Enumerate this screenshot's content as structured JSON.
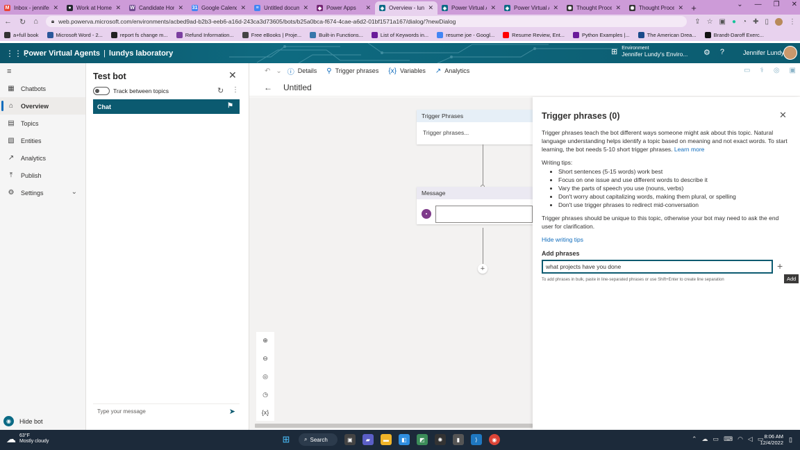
{
  "browser": {
    "tabs": [
      {
        "label": "Inbox - jennifer",
        "icon": "gmail-icon",
        "color": "#ea4335",
        "glyph": "M"
      },
      {
        "label": "Work at Home D",
        "icon": "github-icon",
        "color": "#24292e",
        "glyph": "●"
      },
      {
        "label": "Candidate Hom",
        "icon": "w-icon",
        "color": "#6d4a8c",
        "glyph": "W"
      },
      {
        "label": "Google Calenda",
        "icon": "calendar-icon",
        "color": "#4285f4",
        "glyph": "31"
      },
      {
        "label": "Untitled docum",
        "icon": "docs-icon",
        "color": "#4285f4",
        "glyph": "≡"
      },
      {
        "label": "Power Apps",
        "icon": "powerapps-icon",
        "color": "#742774",
        "glyph": "◆"
      },
      {
        "label": "Overview - lund",
        "icon": "pva-icon",
        "color": "#0b6a85",
        "glyph": "◈"
      },
      {
        "label": "Power Virtual A",
        "icon": "pva-icon",
        "color": "#0b6a85",
        "glyph": "◈"
      },
      {
        "label": "Power Virtual A",
        "icon": "pva-icon",
        "color": "#0b6a85",
        "glyph": "◈"
      },
      {
        "label": "Thought Proce",
        "icon": "chatgpt-icon",
        "color": "#333333",
        "glyph": "✺"
      },
      {
        "label": "Thought Proce",
        "icon": "chatgpt-icon",
        "color": "#333333",
        "glyph": "✺"
      }
    ],
    "active_tab_index": 6,
    "url": "web.powerva.microsoft.com/environments/acbed9ad-b2b3-eeb6-a16d-243ca3d73605/bots/b25a0bca-f674-4cae-a6d2-01bf1571a167/dialog/?newDialog",
    "bookmarks": [
      {
        "label": "a+full book",
        "color": "#333"
      },
      {
        "label": "Microsoft Word - 2...",
        "color": "#2b579a"
      },
      {
        "label": "report fs change m...",
        "color": "#222"
      },
      {
        "label": "Refund Information...",
        "color": "#7b3fa0"
      },
      {
        "label": "Free eBooks | Proje...",
        "color": "#444"
      },
      {
        "label": "Built-in Functions...",
        "color": "#3776ab"
      },
      {
        "label": "List of Keywords in...",
        "color": "#6a1b9a"
      },
      {
        "label": "resume joe - Googl...",
        "color": "#4285f4"
      },
      {
        "label": "Resume Review, Ent...",
        "color": "#ff0000"
      },
      {
        "label": "Python Examples |...",
        "color": "#6a1b9a"
      },
      {
        "label": "The American Drea...",
        "color": "#1a4a8a"
      },
      {
        "label": "Brandt-Daroff Exerc...",
        "color": "#111"
      }
    ]
  },
  "app": {
    "product": "Power Virtual Agents",
    "separator": "|",
    "bot_name": "lundys laboratory",
    "env_label": "Environment",
    "env_name": "Jennifer Lundy's Enviro...",
    "user_name": "Jennifer Lundy"
  },
  "nav": {
    "items": [
      {
        "label": "Chatbots",
        "icon": "chatbots-icon",
        "glyph": "▦"
      },
      {
        "label": "Overview",
        "icon": "home-icon",
        "glyph": "⌂",
        "selected": true
      },
      {
        "label": "Topics",
        "icon": "topics-icon",
        "glyph": "▤"
      },
      {
        "label": "Entities",
        "icon": "entities-icon",
        "glyph": "▧"
      },
      {
        "label": "Analytics",
        "icon": "analytics-icon",
        "glyph": "↗"
      },
      {
        "label": "Publish",
        "icon": "publish-icon",
        "glyph": "⤒"
      },
      {
        "label": "Settings",
        "icon": "settings-icon",
        "glyph": "⚙"
      }
    ],
    "hide_bot": "Hide bot"
  },
  "testbot": {
    "title": "Test bot",
    "track_label": "Track between topics",
    "chat_label": "Chat",
    "input_placeholder": "Type your message"
  },
  "toolbar": {
    "details": "Details",
    "trigger_phrases": "Trigger phrases",
    "variables": "Variables",
    "analytics": "Analytics",
    "topic_title": "Untitled"
  },
  "canvas": {
    "trigger_node_title": "Trigger Phrases",
    "trigger_node_body": "Trigger phrases...",
    "message_node_title": "Message"
  },
  "panel": {
    "title": "Trigger phrases (0)",
    "description": "Trigger phrases teach the bot different ways someone might ask about this topic. Natural language understanding helps identify a topic based on meaning and not exact words. To start learning, the bot needs 5-10 short trigger phrases.",
    "learn_more": "Learn more",
    "tips_heading": "Writing tips:",
    "tips": [
      "Short sentences (5-15 words) work best",
      "Focus on one issue and use different words to describe it",
      "Vary the parts of speech you use (nouns, verbs)",
      "Don't worry about capitalizing words, making them plural, or spelling",
      "Don't use trigger phrases to redirect mid-conversation"
    ],
    "uniqueness": "Trigger phrases should be unique to this topic, otherwise your bot may need to ask the end user for clarification.",
    "hide_tips": "Hide writing tips",
    "add_heading": "Add phrases",
    "phrase_value": "what projects have you done",
    "add_tooltip": "Add",
    "bulk_hint": "To add phrases in bulk, paste in line-separated phrases or use Shift+Enter to create line separation"
  },
  "taskbar": {
    "temp": "63°F",
    "weather": "Mostly cloudy",
    "search": "Search",
    "time": "8:06 AM",
    "date": "12/4/2022"
  },
  "colors": {
    "accent": "#0b5a70",
    "link": "#0f6cbd",
    "browser_frame": "#cd9bd8"
  }
}
